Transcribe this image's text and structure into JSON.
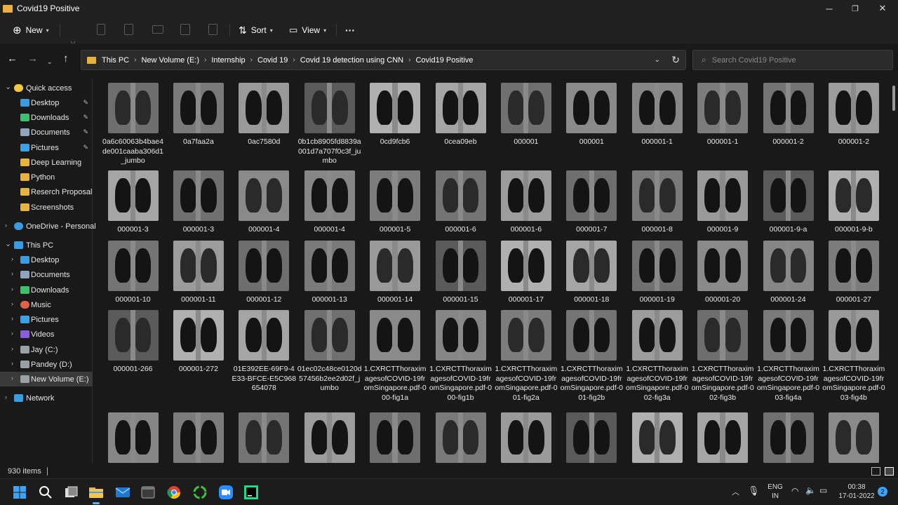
{
  "window": {
    "title": "Covid19 Positive",
    "minimize": "─",
    "maximize": "❐",
    "close": "✕"
  },
  "toolbar": {
    "new_label": "New",
    "sort_label": "Sort",
    "view_label": "View",
    "more_label": "···"
  },
  "address": {
    "crumbs": [
      "This PC",
      "New Volume (E:)",
      "Internship",
      "Covid 19",
      "Covid 19 detection using CNN",
      "Covid19 Positive"
    ]
  },
  "search": {
    "placeholder": "Search Covid19 Positive"
  },
  "sidebar": {
    "items": [
      {
        "label": "Quick access",
        "icon": "star-icon",
        "color": "#f2c744",
        "pinned": false
      },
      {
        "label": "Desktop",
        "icon": "desktop-icon",
        "color": "#3a9be0",
        "pinned": true
      },
      {
        "label": "Downloads",
        "icon": "download-icon",
        "color": "#3fbf6e",
        "pinned": true
      },
      {
        "label": "Documents",
        "icon": "documents-icon",
        "color": "#8fa4bf",
        "pinned": true
      },
      {
        "label": "Pictures",
        "icon": "pictures-icon",
        "color": "#3aa0e8",
        "pinned": true
      },
      {
        "label": "Deep Learning",
        "icon": "folder-icon",
        "color": "#e8b33d",
        "pinned": false
      },
      {
        "label": "Python",
        "icon": "folder-icon",
        "color": "#e8b33d",
        "pinned": false
      },
      {
        "label": "Reserch Proposal",
        "icon": "folder-icon",
        "color": "#e8b33d",
        "pinned": false
      },
      {
        "label": "Screenshots",
        "icon": "folder-icon",
        "color": "#e8b33d",
        "pinned": false
      },
      {
        "label": "OneDrive - Personal",
        "icon": "cloud-icon",
        "color": "#3a9be0",
        "pinned": false
      },
      {
        "label": "This PC",
        "icon": "pc-icon",
        "color": "#3a9be0",
        "pinned": false
      },
      {
        "label": "Desktop",
        "icon": "desktop-icon",
        "color": "#3a9be0",
        "pinned": false
      },
      {
        "label": "Documents",
        "icon": "documents-icon",
        "color": "#8fa4bf",
        "pinned": false
      },
      {
        "label": "Downloads",
        "icon": "download-icon",
        "color": "#3fbf6e",
        "pinned": false
      },
      {
        "label": "Music",
        "icon": "music-icon",
        "color": "#e0604a",
        "pinned": false
      },
      {
        "label": "Pictures",
        "icon": "pictures-icon",
        "color": "#3aa0e8",
        "pinned": false
      },
      {
        "label": "Videos",
        "icon": "videos-icon",
        "color": "#8a5ce0",
        "pinned": false
      },
      {
        "label": "Jay (C:)",
        "icon": "drive-icon",
        "color": "#9aa0a8",
        "pinned": false
      },
      {
        "label": "Pandey (D:)",
        "icon": "drive-icon",
        "color": "#9aa0a8",
        "pinned": false
      },
      {
        "label": "New Volume (E:)",
        "icon": "drive-icon",
        "color": "#9aa0a8",
        "pinned": false
      },
      {
        "label": "Network",
        "icon": "network-icon",
        "color": "#3a9be0",
        "pinned": false
      }
    ]
  },
  "files": {
    "rows": [
      [
        "0a6c60063b4bae4de001caaba306d1_jumbo",
        "0a7faa2a",
        "0ac7580d",
        "0b1cb8905fd8839a001d7a707f0c3f_jumbo",
        "0cd9fcb6",
        "0cea09eb",
        "000001",
        "000001",
        "000001-1",
        "000001-1",
        "000001-2",
        "000001-2"
      ],
      [
        "000001-3",
        "000001-3",
        "000001-4",
        "000001-4",
        "000001-5",
        "000001-6",
        "000001-6",
        "000001-7",
        "000001-8",
        "000001-9",
        "000001-9-a",
        "000001-9-b"
      ],
      [
        "000001-10",
        "000001-11",
        "000001-12",
        "000001-13",
        "000001-14",
        "000001-15",
        "000001-17",
        "000001-18",
        "000001-19",
        "000001-20",
        "000001-24",
        "000001-27"
      ],
      [
        "000001-266",
        "000001-272",
        "01E392EE-69F9-4E33-BFCE-E5C968654078",
        "01ec02c48ce0120d57456b2ee2d02f_jumbo",
        "1.CXRCTThoraximagesofCOVID-19fromSingapore.pdf-000-fig1a",
        "1.CXRCTThoraximagesofCOVID-19fromSingapore.pdf-000-fig1b",
        "1.CXRCTThoraximagesofCOVID-19fromSingapore.pdf-001-fig2a",
        "1.CXRCTThoraximagesofCOVID-19fromSingapore.pdf-001-fig2b",
        "1.CXRCTThoraximagesofCOVID-19fromSingapore.pdf-002-fig3a",
        "1.CXRCTThoraximagesofCOVID-19fromSingapore.pdf-002-fig3b",
        "1.CXRCTThoraximagesofCOVID-19fromSingapore.pdf-003-fig4a",
        "1.CXRCTThoraximagesofCOVID-19fromSingapore.pdf-003-fig4b"
      ],
      [
        "",
        "",
        "",
        "",
        "",
        "",
        "",
        "",
        "",
        "",
        "",
        ""
      ]
    ]
  },
  "status": {
    "item_count": "930 items"
  },
  "taskbar": {
    "apps": [
      "start-icon",
      "search-icon",
      "task-view-icon",
      "file-explorer-icon",
      "mail-icon",
      "terminal-icon",
      "chrome-icon",
      "circle-app-icon",
      "zoom-icon",
      "pycharm-icon"
    ],
    "lang": "ENG",
    "region": "IN",
    "time": "00:38",
    "date": "17-01-2022",
    "notif_count": "2"
  }
}
